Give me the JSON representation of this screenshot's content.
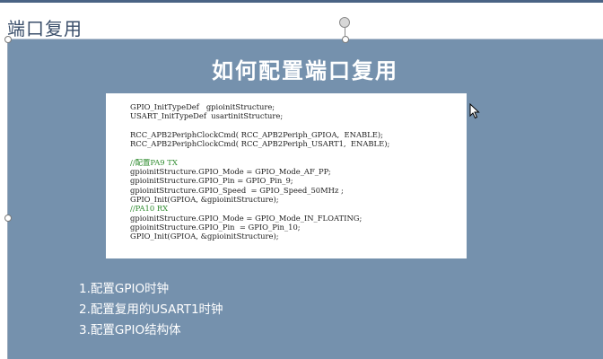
{
  "outline_title": "端口复用",
  "slide": {
    "title": "如何配置端口复用",
    "code_lines": [
      {
        "text": "GPIO_InitTypeDef   gpioinitStructure;",
        "type": "code"
      },
      {
        "text": "USART_InitTypeDef  usartinitStructure;",
        "type": "code"
      },
      {
        "text": "",
        "type": "blank"
      },
      {
        "text": "RCC_APB2PeriphClockCmd( RCC_APB2Periph_GPIOA,  ENABLE);",
        "type": "code"
      },
      {
        "text": "RCC_APB2PeriphClockCmd( RCC_APB2Periph_USART1,  ENABLE);",
        "type": "code"
      },
      {
        "text": "",
        "type": "blank"
      },
      {
        "text": "//配置PA9 TX",
        "type": "comment"
      },
      {
        "text": "gpioinitStructure.GPIO_Mode = GPIO_Mode_AF_PP;",
        "type": "code"
      },
      {
        "text": "gpioinitStructure.GPIO_Pin = GPIO_Pin_9;",
        "type": "code"
      },
      {
        "text": "gpioinitStructure.GPIO_Speed  = GPIO_Speed_50MHz ;",
        "type": "code"
      },
      {
        "text": "GPIO_Init(GPIOA, &gpioinitStructure);",
        "type": "code"
      },
      {
        "text": "//PA10 RX",
        "type": "comment"
      },
      {
        "text": "gpioinitStructure.GPIO_Mode = GPIO_Mode_IN_FLOATING;",
        "type": "code"
      },
      {
        "text": "gpioinitStructure.GPIO_Pin  = GPIO_Pin_10;",
        "type": "code"
      },
      {
        "text": "GPIO_Init(GPIOA, &gpioinitStructure);",
        "type": "code"
      }
    ],
    "bullets": [
      "1.配置GPIO时钟",
      "2.配置复用的USART1时钟",
      "3.配置GPIO结构体"
    ]
  },
  "colors": {
    "slide_bg": "#7591ad",
    "title_text": "#ffffff",
    "comment": "#2e8b2e",
    "outline_title": "#3b4f6b"
  },
  "icons": {
    "rotate_handle": "rotate-handle-icon",
    "cursor": "cursor-icon"
  }
}
